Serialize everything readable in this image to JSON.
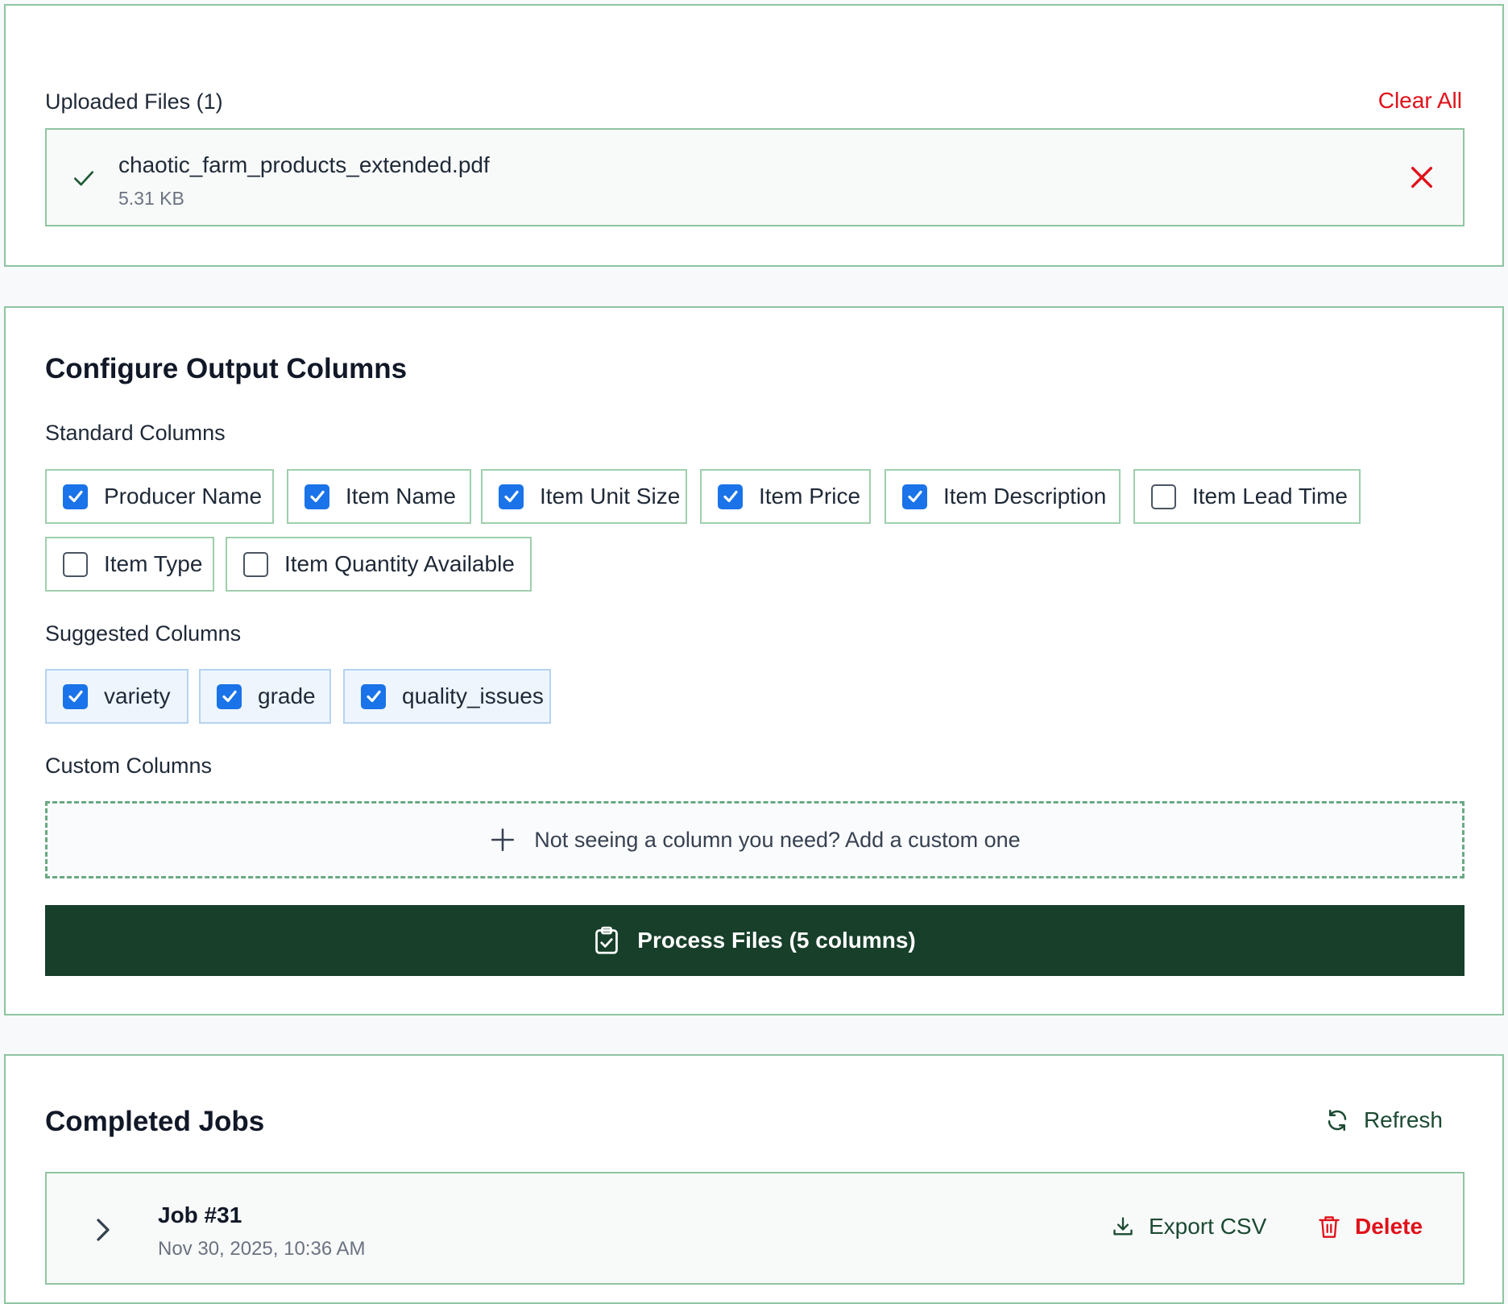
{
  "files": {
    "title": "Uploaded Files (1)",
    "clear_all": "Clear All",
    "items": [
      {
        "name": "chaotic_farm_products_extended.pdf",
        "size": "5.31 KB",
        "status_icon": "check-icon",
        "remove_icon": "close-icon"
      }
    ]
  },
  "config": {
    "title": "Configure Output Columns",
    "standard_label": "Standard Columns",
    "standard_columns": [
      {
        "label": "Producer Name",
        "checked": true
      },
      {
        "label": "Item Name",
        "checked": true
      },
      {
        "label": "Item Unit Size",
        "checked": true
      },
      {
        "label": "Item Price",
        "checked": true
      },
      {
        "label": "Item Description",
        "checked": true
      },
      {
        "label": "Item Lead Time",
        "checked": false
      },
      {
        "label": "Item Type",
        "checked": false
      },
      {
        "label": "Item Quantity Available",
        "checked": false
      }
    ],
    "suggested_label": "Suggested Columns",
    "suggested_columns": [
      {
        "label": "variety",
        "checked": true
      },
      {
        "label": "grade",
        "checked": true
      },
      {
        "label": "quality_issues",
        "checked": true
      }
    ],
    "custom_label": "Custom Columns",
    "add_custom": "Not seeing a column you need? Add a custom one",
    "process_button": "Process Files (5 columns)"
  },
  "jobs": {
    "title": "Completed Jobs",
    "refresh": "Refresh",
    "items": [
      {
        "title": "Job #31",
        "date": "Nov 30, 2025, 10:36 AM",
        "export": "Export CSV",
        "delete": "Delete"
      }
    ]
  },
  "colors": {
    "accent_dark_green": "#173f2a",
    "border_green": "#8fc4a1",
    "danger_red": "#e0111a",
    "checkbox_blue": "#1a73e8",
    "suggested_bg": "#eef5fd"
  }
}
